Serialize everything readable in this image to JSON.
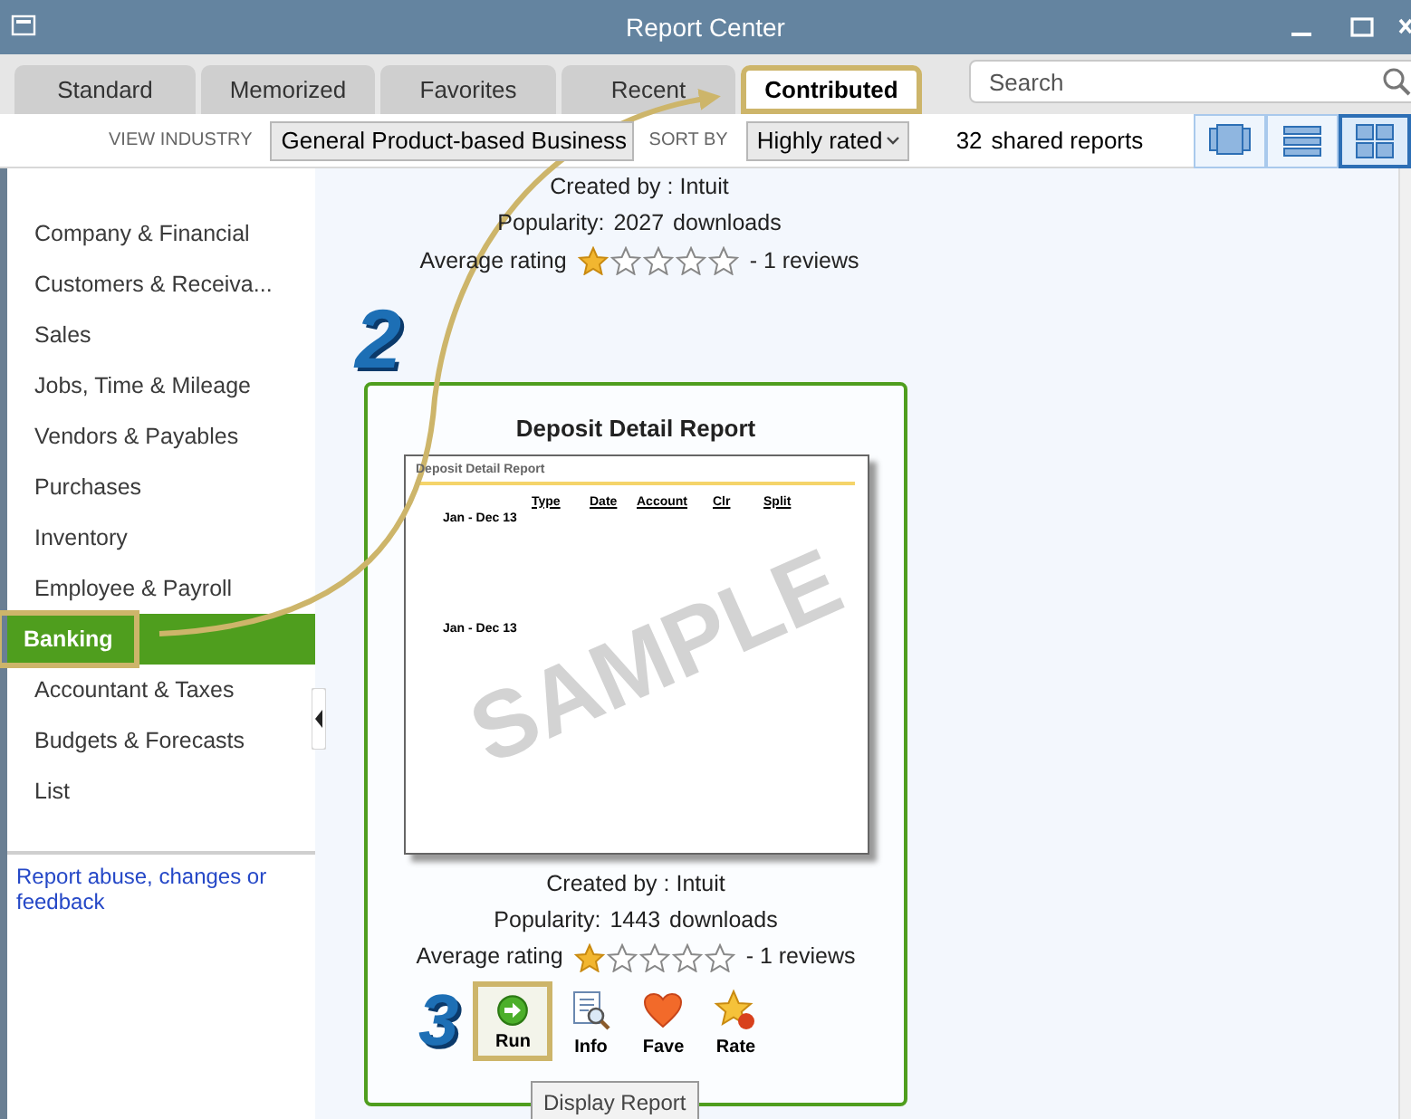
{
  "window": {
    "title": "Report Center"
  },
  "tabs": [
    {
      "label": "Standard",
      "selected": false,
      "highlighted": false
    },
    {
      "label": "Memorized",
      "selected": false,
      "highlighted": false
    },
    {
      "label": "Favorites",
      "selected": false,
      "highlighted": false
    },
    {
      "label": "Recent",
      "selected": false,
      "highlighted": false
    },
    {
      "label": "Contributed",
      "selected": true,
      "highlighted": true
    }
  ],
  "search": {
    "placeholder": "Search"
  },
  "toolbar": {
    "industry_label": "VIEW INDUSTRY",
    "industry": "General Product-based Business",
    "sort_label": "SORT BY",
    "sort": "Highly rated",
    "count": "32",
    "count_label": "shared reports",
    "views": [
      {
        "kind": "carousel",
        "selected": false
      },
      {
        "kind": "list",
        "selected": false
      },
      {
        "kind": "grid",
        "selected": true
      }
    ]
  },
  "sidebar": {
    "items": [
      {
        "label": "Company & Financial",
        "selected": false,
        "highlighted": false
      },
      {
        "label": "Customers & Receiva...",
        "selected": false,
        "highlighted": false
      },
      {
        "label": "Sales",
        "selected": false,
        "highlighted": false
      },
      {
        "label": "Jobs, Time & Mileage",
        "selected": false,
        "highlighted": false
      },
      {
        "label": "Vendors & Payables",
        "selected": false,
        "highlighted": false
      },
      {
        "label": "Purchases",
        "selected": false,
        "highlighted": false
      },
      {
        "label": "Inventory",
        "selected": false,
        "highlighted": false
      },
      {
        "label": "Employee & Payroll",
        "selected": false,
        "highlighted": false
      },
      {
        "label": "Banking",
        "selected": true,
        "highlighted": true
      },
      {
        "label": "Accountant & Taxes",
        "selected": false,
        "highlighted": false
      },
      {
        "label": "Budgets & Forecasts",
        "selected": false,
        "highlighted": false
      },
      {
        "label": "List",
        "selected": false,
        "highlighted": false
      }
    ],
    "feedback_link": "Report abuse, changes or feedback"
  },
  "reports": [
    {
      "created_by": "Created by : Intuit",
      "popularity_label": "Popularity:",
      "downloads": "2027",
      "downloads_label": "downloads",
      "rating_label": "Average rating",
      "stars": 1,
      "reviews": "- 1 reviews"
    },
    {
      "title": "Deposit Detail Report",
      "preview": {
        "heading": "Deposit Detail Report",
        "columns": [
          "Type",
          "Date",
          "Account",
          "Clr",
          "Split"
        ],
        "rows": [
          "Jan - Dec 13",
          "Jan - Dec 13"
        ],
        "stamp": "SAMPLE"
      },
      "created_by": "Created by : Intuit",
      "popularity_label": "Popularity:",
      "downloads": "1443",
      "downloads_label": "downloads",
      "rating_label": "Average rating",
      "stars": 1,
      "reviews": "- 1 reviews",
      "actions": [
        {
          "kind": "run",
          "label": "Run",
          "highlighted": true
        },
        {
          "kind": "info",
          "label": "Info",
          "highlighted": false
        },
        {
          "kind": "fave",
          "label": "Fave",
          "highlighted": false
        },
        {
          "kind": "rate",
          "label": "Rate",
          "highlighted": false
        }
      ]
    }
  ],
  "tooltip": "Display Report",
  "callouts": [
    "2",
    "3"
  ]
}
